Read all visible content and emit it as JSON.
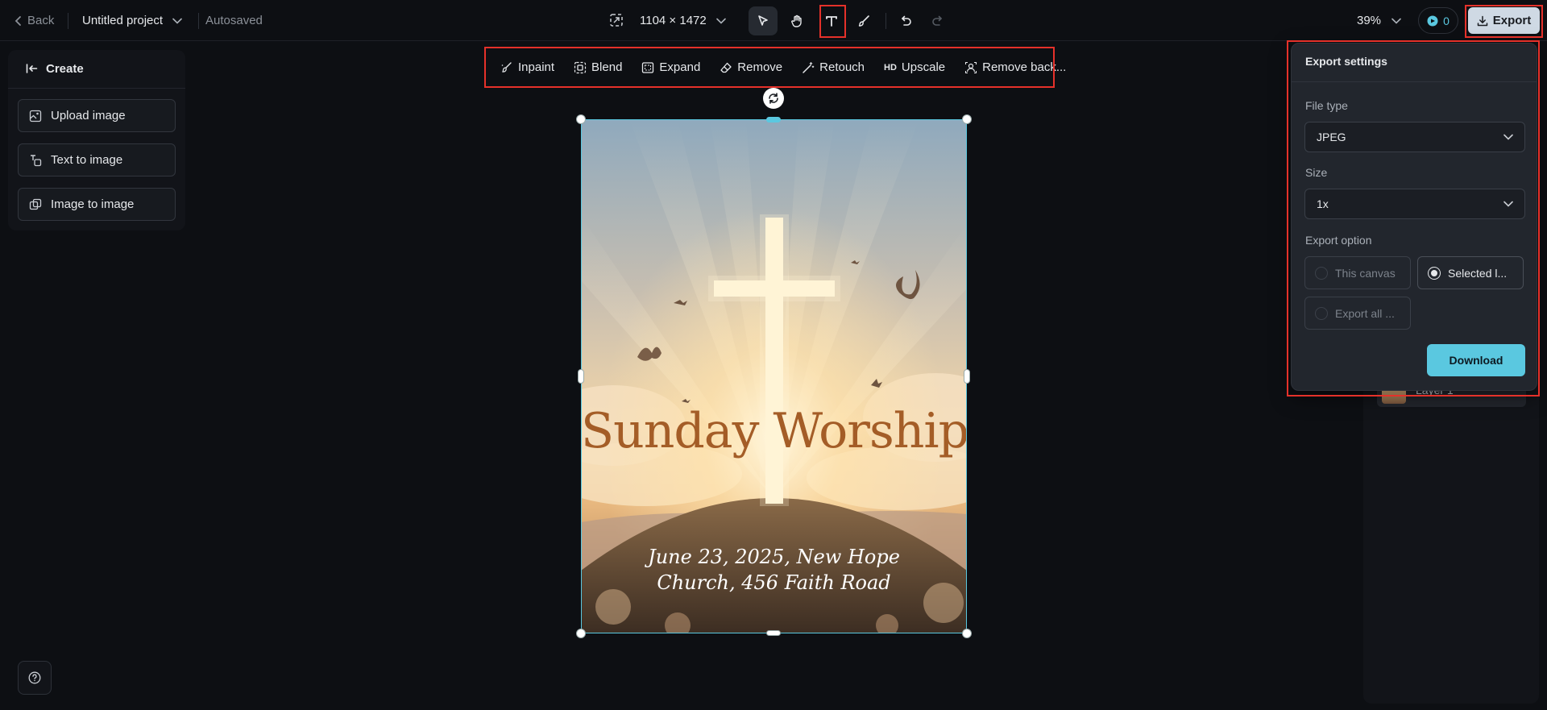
{
  "topbar": {
    "back_label": "Back",
    "project_name": "Untitled project",
    "save_status": "Autosaved",
    "canvas_size": "1104 × 1472",
    "zoom": "39%",
    "credits": "0",
    "export_label": "Export"
  },
  "left_panel": {
    "header": "Create",
    "items": [
      {
        "label": "Upload image"
      },
      {
        "label": "Text to image"
      },
      {
        "label": "Image to image"
      }
    ]
  },
  "edit_toolbar": {
    "items": [
      {
        "label": "Inpaint"
      },
      {
        "label": "Blend"
      },
      {
        "label": "Expand"
      },
      {
        "label": "Remove"
      },
      {
        "label": "Retouch"
      },
      {
        "label": "Upscale",
        "prefix": "HD"
      },
      {
        "label": "Remove back..."
      }
    ]
  },
  "poster": {
    "title": "Sunday Worship",
    "subtitle_line1": "June 23, 2025, New Hope",
    "subtitle_line2": "Church, 456 Faith Road"
  },
  "layers_panel": {
    "layer_name": "Layer 1"
  },
  "export_popover": {
    "title": "Export settings",
    "file_type_label": "File type",
    "file_type_value": "JPEG",
    "size_label": "Size",
    "size_value": "1x",
    "export_option_label": "Export option",
    "options": [
      {
        "label": "This canvas",
        "selected": false
      },
      {
        "label": "Selected l...",
        "selected": true
      },
      {
        "label": "Export all ...",
        "selected": false
      }
    ],
    "download_label": "Download"
  },
  "colors": {
    "accent": "#5ac8e0",
    "highlight_box": "#e5312a",
    "title_brown": "#a45d27"
  }
}
